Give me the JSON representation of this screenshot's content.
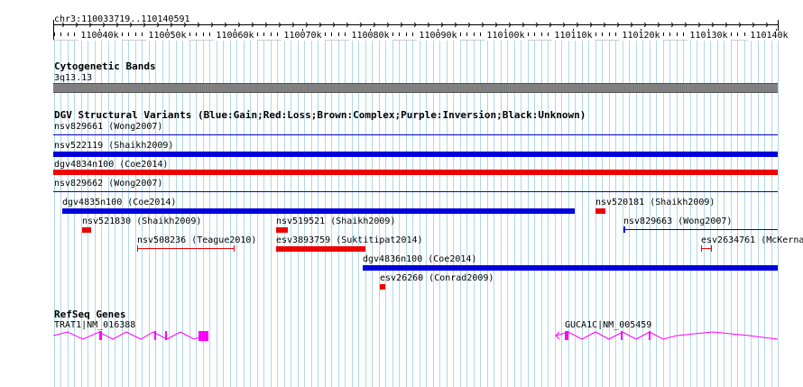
{
  "ruler": {
    "region": "chr3:110033719..110140591",
    "ticks": [
      "110040k",
      "110050k",
      "110060k",
      "110070k",
      "110080k",
      "110090k",
      "110100k",
      "110110k",
      "110120k",
      "110130k",
      "110140k"
    ]
  },
  "cytoband": {
    "title": "Cytogenetic Bands",
    "band": "3q13.13"
  },
  "dgv": {
    "title": "DGV Structural Variants (Blue:Gain;Red:Loss;Brown:Complex;Purple:Inversion;Black:Unknown)",
    "variants": [
      {
        "label": "nsv829661 (Wong2007)",
        "kind": "gain"
      },
      {
        "label": "nsv522119 (Shaikh2009)",
        "kind": "gain"
      },
      {
        "label": "dgv4834n100 (Coe2014)",
        "kind": "loss"
      },
      {
        "label": "nsv829662 (Wong2007)",
        "kind": "gain"
      },
      {
        "label": "dgv4835n100 (Coe2014)",
        "kind": "gain"
      },
      {
        "label": "nsv520181 (Shaikh2009)",
        "kind": "loss"
      },
      {
        "label": "nsv521830 (Shaikh2009)",
        "kind": "loss"
      },
      {
        "label": "nsv519521 (Shaikh2009)",
        "kind": "loss"
      },
      {
        "label": "nsv829663 (Wong2007)",
        "kind": "gain"
      },
      {
        "label": "nsv508236 (Teague2010)",
        "kind": "loss"
      },
      {
        "label": "esv3893759 (Suktitipat2014)",
        "kind": "loss"
      },
      {
        "label": "esv2634761 (McKerna",
        "kind": "loss"
      },
      {
        "label": "dgv4836n100 (Coe2014)",
        "kind": "gain"
      },
      {
        "label": "esv26260 (Conrad2009)",
        "kind": "loss"
      }
    ]
  },
  "refseq": {
    "title": "RefSeq Genes",
    "genes": [
      {
        "label": "TRAT1|NM_016388"
      },
      {
        "label": "GUCA1C|NM_005459"
      }
    ]
  },
  "colors": {
    "gain": "#0000dd",
    "loss": "#ee0000",
    "gene": "#ff00ff",
    "grid": "#add8e6",
    "band": "#808080"
  }
}
